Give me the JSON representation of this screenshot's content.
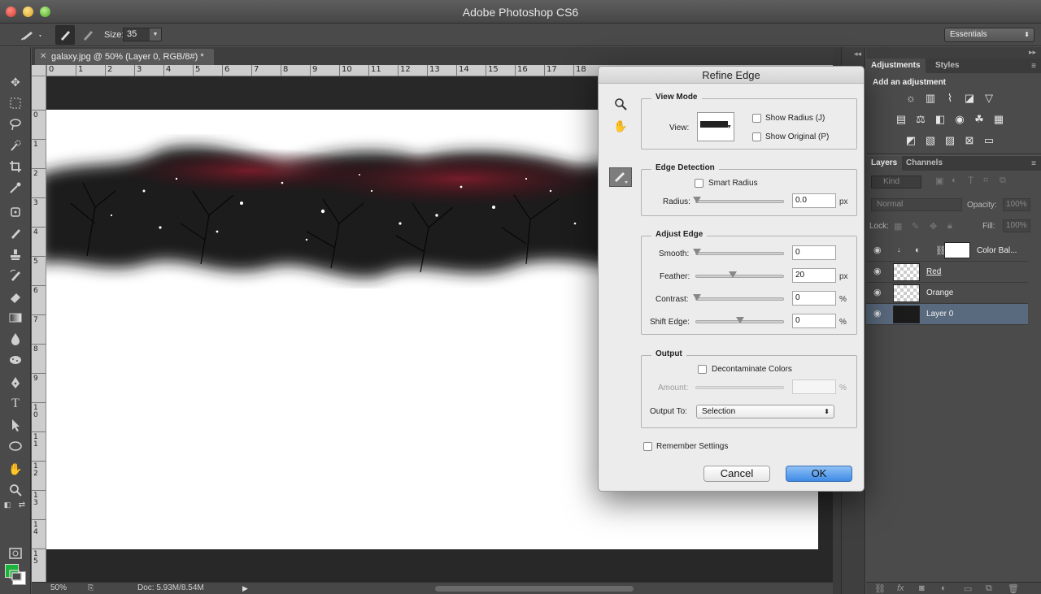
{
  "app": {
    "title": "Adobe Photoshop CS6"
  },
  "options_bar": {
    "size_label": "Size:",
    "size_value": "35",
    "workspace": "Essentials"
  },
  "document": {
    "tab_title": "galaxy.jpg @ 50% (Layer 0, RGB/8#) *",
    "zoom": "50%",
    "doc_info": "Doc: 5.93M/8.54M"
  },
  "ruler": {
    "h_ticks": [
      "0",
      "1",
      "2",
      "3",
      "4",
      "5",
      "6",
      "7",
      "8",
      "9",
      "10",
      "11",
      "12",
      "13",
      "14",
      "15",
      "16",
      "17",
      "18"
    ],
    "v_ticks": [
      "0",
      "1",
      "2",
      "3",
      "4",
      "5",
      "6",
      "7",
      "8",
      "9",
      "10",
      "11",
      "12",
      "13",
      "14",
      "15"
    ]
  },
  "adjustments_panel": {
    "tabs": [
      "Adjustments",
      "Styles"
    ],
    "heading": "Add an adjustment"
  },
  "layers_panel": {
    "tabs": [
      "Layers",
      "Channels"
    ],
    "kind": "Kind",
    "blend_mode": "Normal",
    "opacity_label": "Opacity:",
    "opacity": "100%",
    "lock_label": "Lock:",
    "fill_label": "Fill:",
    "fill": "100%",
    "layers": [
      {
        "name": "Color Bal...",
        "thumb": "white"
      },
      {
        "name": "Red",
        "thumb": "transparent"
      },
      {
        "name": "Orange",
        "thumb": "transparent"
      },
      {
        "name": "Layer 0",
        "thumb": "dark",
        "selected": true
      }
    ]
  },
  "refine_edge": {
    "title": "Refine Edge",
    "view_mode": {
      "heading": "View Mode",
      "view_label": "View:",
      "show_radius": "Show Radius (J)",
      "show_original": "Show Original (P)"
    },
    "edge_detection": {
      "heading": "Edge Detection",
      "smart_radius": "Smart Radius",
      "radius_label": "Radius:",
      "radius_value": "0.0",
      "unit": "px"
    },
    "adjust_edge": {
      "heading": "Adjust Edge",
      "smooth_label": "Smooth:",
      "smooth_value": "0",
      "feather_label": "Feather:",
      "feather_value": "20",
      "feather_unit": "px",
      "contrast_label": "Contrast:",
      "contrast_value": "0",
      "contrast_unit": "%",
      "shift_label": "Shift Edge:",
      "shift_value": "0",
      "shift_unit": "%"
    },
    "output": {
      "heading": "Output",
      "decontaminate": "Decontaminate Colors",
      "amount_label": "Amount:",
      "amount_unit": "%",
      "output_to_label": "Output To:",
      "output_to_value": "Selection"
    },
    "remember": "Remember Settings",
    "cancel": "Cancel",
    "ok": "OK"
  },
  "colors": {
    "foreground": "#1cb33a",
    "background": "#ffffff"
  }
}
